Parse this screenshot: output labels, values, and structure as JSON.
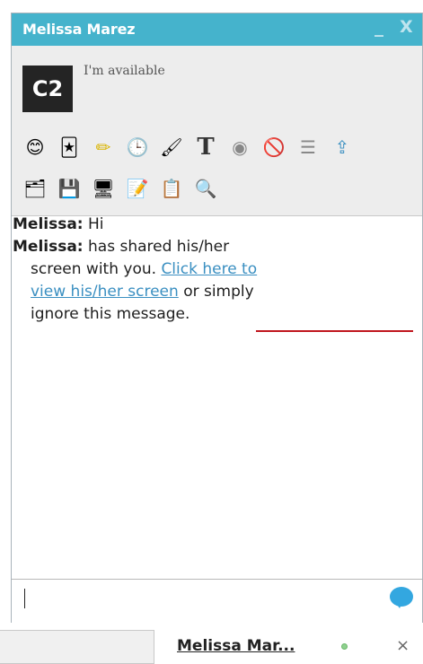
{
  "window": {
    "title": "Melissa Marez",
    "minimize_glyph": "_",
    "close_glyph": "X"
  },
  "profile": {
    "avatar_text": "C2",
    "status": "I'm available"
  },
  "toolbar": {
    "row1": [
      {
        "icon": "emoticon-icon",
        "glyph": "😊"
      },
      {
        "icon": "card-icon",
        "glyph": "🃏"
      },
      {
        "icon": "pencil-icon",
        "glyph": "✏"
      },
      {
        "icon": "clock-icon",
        "glyph": "🕒"
      },
      {
        "icon": "brush-icon",
        "glyph": "🖌"
      },
      {
        "icon": "text-format-icon",
        "glyph": "T"
      },
      {
        "icon": "webcam-icon",
        "glyph": "◉"
      },
      {
        "icon": "block-icon",
        "glyph": "🚫"
      },
      {
        "icon": "log-icon",
        "glyph": "☰"
      },
      {
        "icon": "upload-icon",
        "glyph": "⇪"
      }
    ],
    "row2": [
      {
        "icon": "folder-icon",
        "glyph": "🗂"
      },
      {
        "icon": "save-icon",
        "glyph": "💾"
      },
      {
        "icon": "screen-share-icon",
        "glyph": "🖥"
      },
      {
        "icon": "whiteboard-icon",
        "glyph": "📝"
      },
      {
        "icon": "copy-icon",
        "glyph": "📋"
      },
      {
        "icon": "webcam-view-icon",
        "glyph": "🔍"
      }
    ]
  },
  "messages": [
    {
      "sender": "Melissa:",
      "text": "Hi"
    },
    {
      "sender": "Melissa:",
      "text_pre": "has shared his/her",
      "text_line2": "screen with you.",
      "link_line2": "Click here to",
      "link_line3": "view his/her screen",
      "text_post_line3": "or simply",
      "text_line4": "ignore this message."
    }
  ],
  "input": {
    "value": ""
  },
  "taskbar": {
    "chat_name": "Melissa Mar...",
    "close_glyph": "×"
  },
  "colors": {
    "titlebar": "#45b3cc",
    "link": "#3a8fc1",
    "annotation": "#c0161e",
    "online": "#8fd18f"
  }
}
